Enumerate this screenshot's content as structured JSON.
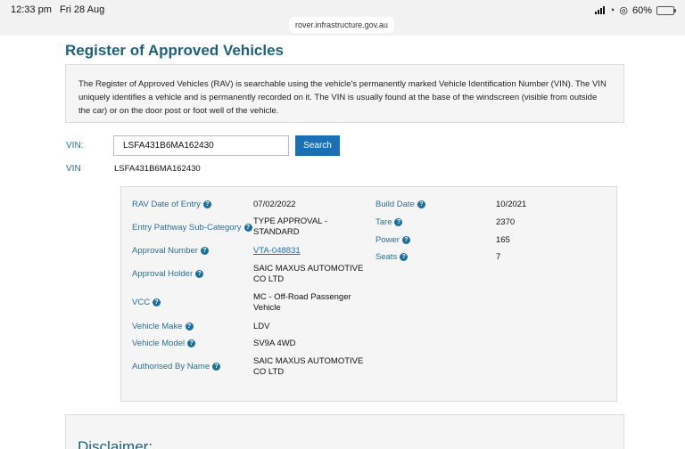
{
  "status": {
    "time": "12:33 pm",
    "date": "Fri 28 Aug",
    "battery": "60%",
    "battery_level": 0.6
  },
  "browser": {
    "url": "rover.infrastructure.gov.au"
  },
  "page": {
    "title": "Register of Approved Vehicles",
    "intro": "The Register of Approved Vehicles (RAV) is searchable using the vehicle's permanently marked Vehicle Identification Number (VIN). The VIN uniquely identifies a vehicle and is permanently recorded on it. The VIN is usually found at the base of the windscreen (visible from outside the car) or on the door post or foot well of the vehicle."
  },
  "search": {
    "label": "VIN:",
    "value": "LSFA431B6MA162430",
    "button": "Search"
  },
  "result": {
    "vin_label": "VIN",
    "vin_value": "LSFA431B6MA162430"
  },
  "details": {
    "rav_date_label": "RAV Date of Entry",
    "rav_date": "07/02/2022",
    "pathway_label": "Entry Pathway Sub-Category",
    "pathway_l1": "TYPE APPROVAL -",
    "pathway_l2": "STANDARD",
    "approval_number_label": "Approval Number",
    "approval_number": "VTA-048831",
    "approval_holder_label": "Approval Holder",
    "approval_holder_l1": "SAIC MAXUS AUTOMOTIVE",
    "approval_holder_l2": "CO LTD",
    "vcc_label": "VCC",
    "vcc_l1": "MC - Off-Road Passenger",
    "vcc_l2": "Vehicle",
    "make_label": "Vehicle Make",
    "make": "LDV",
    "model_label": "Vehicle Model",
    "model": "SV9A 4WD",
    "authorised_label": "Authorised By Name",
    "authorised_l1": "SAIC MAXUS AUTOMOTIVE",
    "authorised_l2": "CO LTD",
    "build_date_label": "Build Date",
    "build_date": "10/2021",
    "tare_label": "Tare",
    "tare": "2370",
    "power_label": "Power",
    "power": "165",
    "seats_label": "Seats",
    "seats": "7"
  },
  "disclaimer": {
    "title": "Disclaimer:"
  },
  "icons": {
    "help": "?"
  }
}
